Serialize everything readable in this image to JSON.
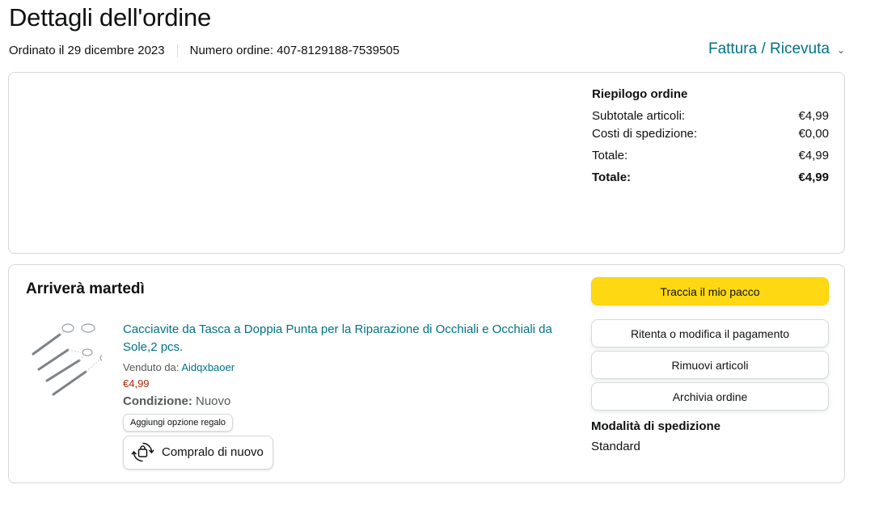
{
  "header": {
    "title": "Dettagli dell'ordine",
    "ordered_on": "Ordinato il 29 dicembre 2023",
    "order_number": "Numero ordine: 407-8129188-7539505",
    "invoice_label": "Fattura / Ricevuta",
    "invoice_icon": "chevron-down-icon"
  },
  "summary": {
    "title": "Riepilogo ordine",
    "rows": [
      {
        "label": "Subtotale articoli:",
        "value": "€4,99"
      },
      {
        "label": "Costi di spedizione:",
        "value": "€0,00"
      },
      {
        "label": "Totale:",
        "value": "€4,99"
      },
      {
        "label": "Totale:",
        "value": "€4,99"
      }
    ]
  },
  "shipment": {
    "arrival": "Arriverà martedì",
    "product": {
      "title": "Cacciavite da Tasca a Doppia Punta per la Riparazione di Occhiali e Occhiali da Sole,2 pcs.",
      "sold_by_label": "Venduto da:",
      "seller": "Aidqxbaoer",
      "price": "€4,99",
      "condition_label": "Condizione:",
      "condition_value": "Nuovo",
      "gift_label": "Aggiungi opzione regalo",
      "buy_again_label": "Compralo di nuovo",
      "buy_again_icon": "buy-again-icon"
    },
    "actions": {
      "track": "Traccia il mio pacco",
      "retry_payment": "Ritenta o modifica il pagamento",
      "remove_items": "Rimuovi articoli",
      "archive": "Archivia ordine"
    },
    "shipping_mode_title": "Modalità di spedizione",
    "shipping_mode_value": "Standard"
  },
  "colors": {
    "link": "#007185",
    "price": "#b12704",
    "primary_button": "#ffd814",
    "border": "#d5d9d9"
  }
}
